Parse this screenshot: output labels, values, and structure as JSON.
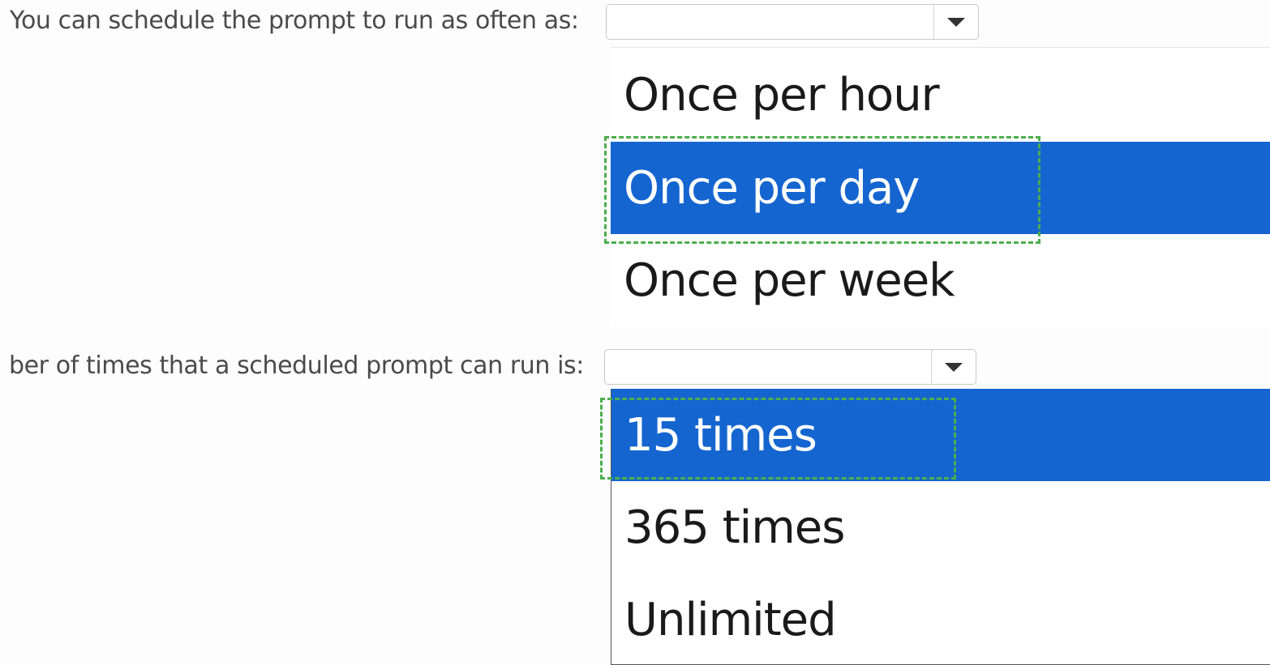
{
  "question_1": {
    "label": "You can schedule the prompt to run as often as:",
    "selected_value": "",
    "options": [
      {
        "label": "Once per hour",
        "selected": false
      },
      {
        "label": "Once per day",
        "selected": true
      },
      {
        "label": "Once per week",
        "selected": false
      }
    ]
  },
  "question_2": {
    "label": "ber of times that a scheduled prompt can run is:",
    "selected_value": "",
    "options": [
      {
        "label": "15 times",
        "selected": true
      },
      {
        "label": "365 times",
        "selected": false
      },
      {
        "label": "Unlimited",
        "selected": false
      }
    ]
  },
  "icons": {
    "dropdown_arrow": "chevron-down-icon"
  },
  "colors": {
    "selected_background": "#1565d0",
    "selected_text": "#ffffff",
    "answer_outline": "#4cae4c",
    "label_text": "#4a4a4a"
  }
}
